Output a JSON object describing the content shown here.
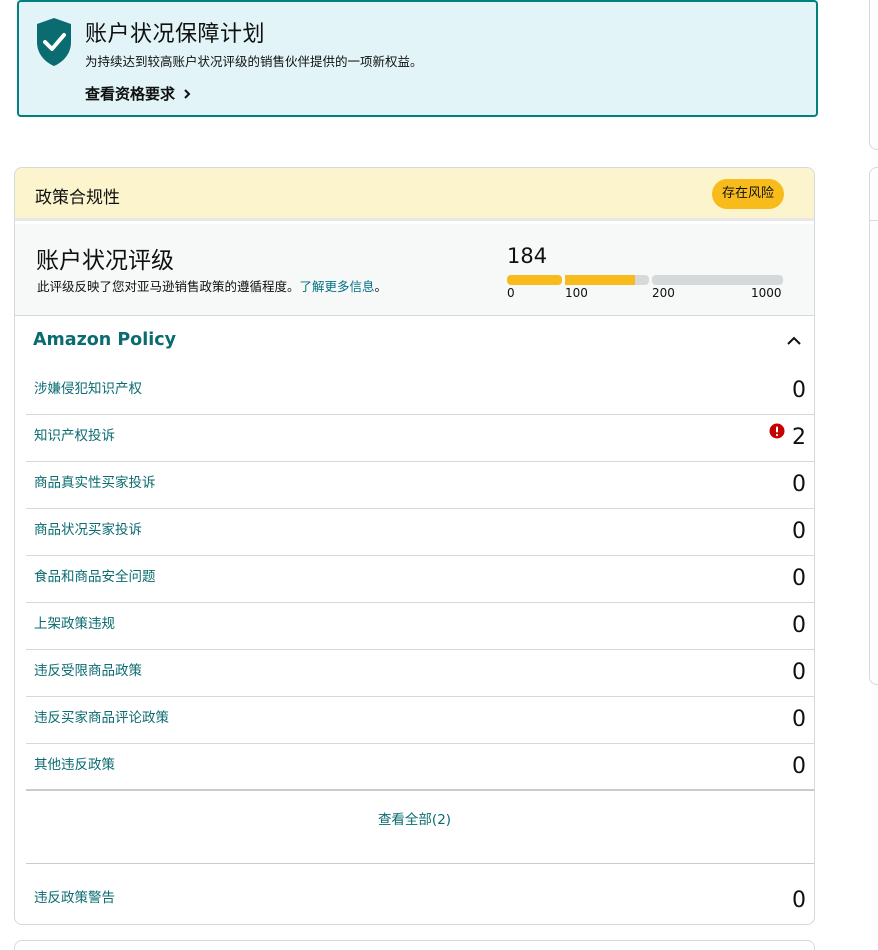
{
  "banner": {
    "title": "账户状况保障计划",
    "subtitle": "为持续达到较高账户状况评级的销售伙伴提供的一项新权益。",
    "link_label": "查看资格要求"
  },
  "policy_card": {
    "header_title": "政策合规性",
    "status_badge": "存在风险",
    "rating": {
      "title": "账户状况评级",
      "description": "此评级反映了您对亚马逊销售政策的遵循程度。",
      "learn_more": "了解更多信息",
      "description_end": "。",
      "score": "184",
      "score_value": 184,
      "scale_ticks": [
        "0",
        "100",
        "200",
        "1000"
      ]
    },
    "section_title": "Amazon Policy",
    "items": [
      {
        "label": "涉嫌侵犯知识产权",
        "count": "0"
      },
      {
        "label": "知识产权投诉",
        "count": "2",
        "alert": true
      },
      {
        "label": "商品真实性买家投诉",
        "count": "0"
      },
      {
        "label": "商品状况买家投诉",
        "count": "0"
      },
      {
        "label": "食品和商品安全问题",
        "count": "0"
      },
      {
        "label": "上架政策违规",
        "count": "0"
      },
      {
        "label": "违反受限商品政策",
        "count": "0"
      },
      {
        "label": "违反买家商品评论政策",
        "count": "0"
      },
      {
        "label": "其他违反政策",
        "count": "0"
      }
    ],
    "view_all": "查看全部(2)",
    "warnings": {
      "label": "违反政策警告",
      "count": "0"
    }
  },
  "colors": {
    "banner_bg": "#e3f4f8",
    "banner_border": "#00807f",
    "header_bg": "#fcf4cd",
    "badge_bg": "#f7bb1c",
    "link_teal": "#0a6b70",
    "bar_filled": "#f7bb1c",
    "bar_empty": "#d5d9d9",
    "alert_red": "#c40000"
  }
}
